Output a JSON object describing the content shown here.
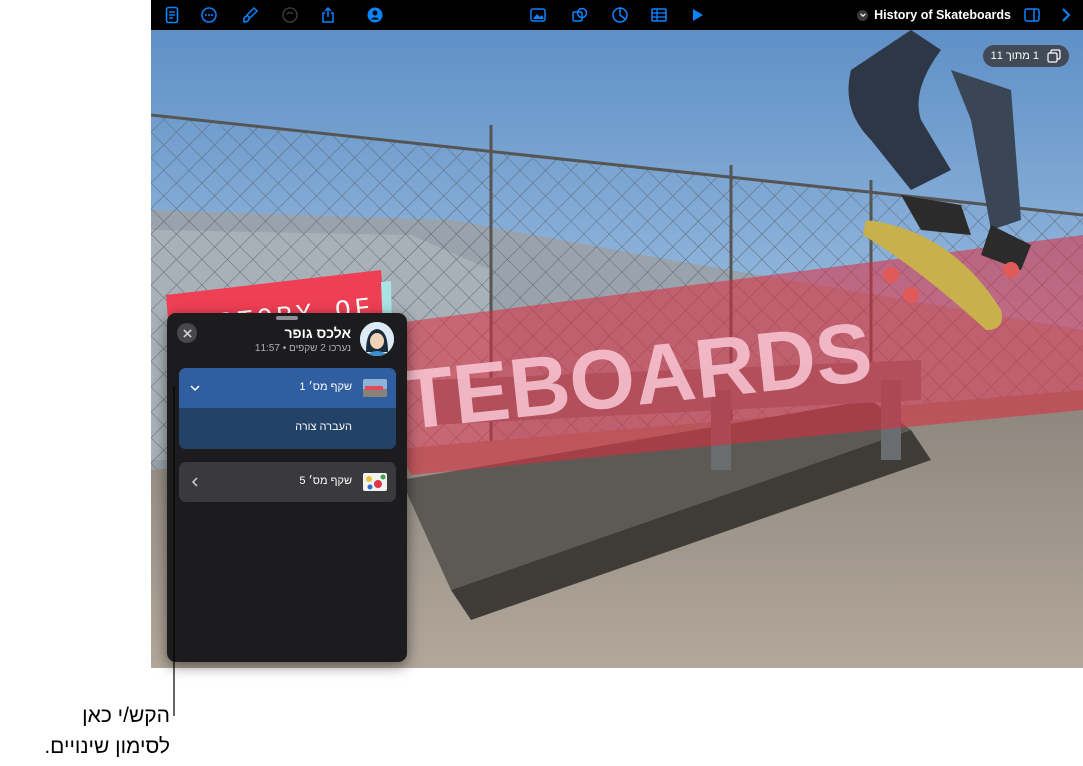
{
  "toolbar": {
    "document_title": "History of Skateboards",
    "left_icons": [
      "document-icon",
      "more-icon",
      "format-brush-icon",
      "undo-icon",
      "share-icon",
      "collaborate-icon"
    ],
    "center_icons": [
      "media-icon",
      "shapes-icon",
      "chart-icon",
      "table-icon",
      "play-icon"
    ],
    "right_icons": [
      "sidebar-icon",
      "next-icon"
    ],
    "accent_color": "#0a84ff"
  },
  "slide": {
    "counter_text": "1 מתוך 11",
    "banner_text": "TEBOARDS",
    "sign_text": "HISTORY OF"
  },
  "panel": {
    "user_name": "אלכס גופר",
    "user_meta": "נערכו 2 שקפים • 11:57",
    "groups": [
      {
        "label": "שקף מס׳ 1",
        "expanded": true,
        "sub_label": "העברה צורה"
      },
      {
        "label": "שקף מס׳ 5",
        "expanded": false
      }
    ]
  },
  "callout": {
    "line1": "הקש/י כאן",
    "line2": "לסימון שינויים."
  }
}
